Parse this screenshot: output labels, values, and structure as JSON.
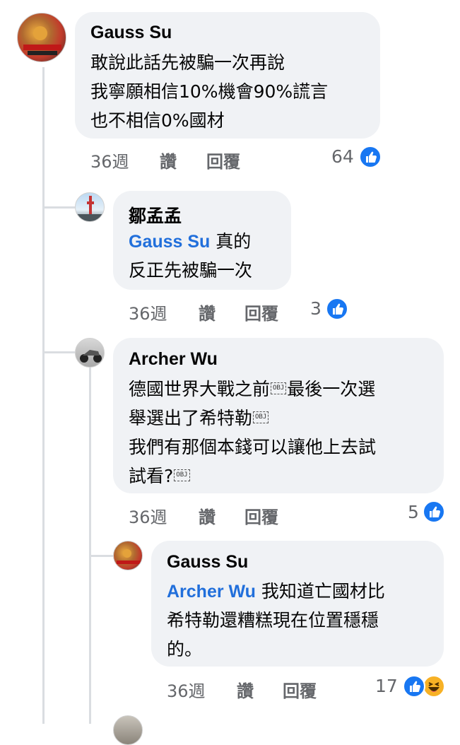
{
  "comments": [
    {
      "author": "Gauss Su",
      "lines": [
        "敢說此話先被騙一次再說",
        "我寧願相信10%機會90%謊言",
        "也不相信0%國材"
      ],
      "time": "36週",
      "like_label": "讚",
      "reply_label": "回覆",
      "reaction_count": "64",
      "reactions": [
        "like-icon"
      ]
    },
    {
      "author": "鄒孟孟",
      "mention": "Gauss Su",
      "lines": [
        " 真的",
        "反正先被騙一次"
      ],
      "time": "36週",
      "like_label": "讚",
      "reply_label": "回覆",
      "reaction_count": "3",
      "reactions": [
        "like-icon"
      ]
    },
    {
      "author": "Archer Wu",
      "lines": [
        "德國世界大戰之前",
        "最後一次選",
        "舉選出了希特勒",
        "我們有那個本錢可以讓他上去試",
        "試看?"
      ],
      "obj_label": "OBJ",
      "time": "36週",
      "like_label": "讚",
      "reply_label": "回覆",
      "reaction_count": "5",
      "reactions": [
        "like-icon"
      ]
    },
    {
      "author": "Gauss Su",
      "mention": "Archer Wu",
      "lines": [
        " 我知道亡國材比",
        "希特勒還糟糕現在位置穩穩",
        "的。"
      ],
      "time": "36週",
      "like_label": "讚",
      "reply_label": "回覆",
      "reaction_count": "17",
      "reactions": [
        "like-icon",
        "haha-icon"
      ]
    }
  ],
  "colors": {
    "bubble": "#f0f2f5",
    "mention": "#216fdb",
    "meta": "#65676b",
    "like": "#1877f2",
    "thread_line": "#dadde1"
  }
}
